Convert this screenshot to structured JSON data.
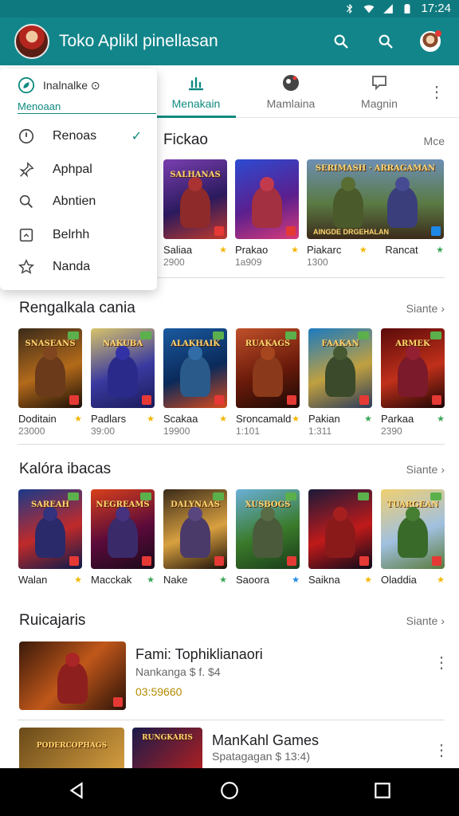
{
  "status": {
    "time": "17:24"
  },
  "app": {
    "title": "Toko Aplikl pinellasan"
  },
  "tabs": [
    {
      "label": ""
    },
    {
      "label": "Menakain"
    },
    {
      "label": "Mamlaina"
    },
    {
      "label": "Magnin"
    }
  ],
  "menu": {
    "header": "Inalnalke ⊙",
    "sub": "Menoaan",
    "items": [
      {
        "label": "Renoas",
        "icon": "info-icon",
        "checked": true
      },
      {
        "label": "Aphpal",
        "icon": "pin-icon"
      },
      {
        "label": "Abntien",
        "icon": "search-icon"
      },
      {
        "label": "Belrhh",
        "icon": "square-icon"
      },
      {
        "label": "Nanda",
        "icon": "star-icon"
      }
    ]
  },
  "sections": {
    "featured": {
      "title": "Fickao",
      "more": "Mce",
      "cards": [
        {
          "cover": "SALHANAS",
          "name": "Saliaa",
          "sub": "2900",
          "star": "y"
        },
        {
          "cover": "",
          "name": "Prakao",
          "sub": "1a909",
          "star": "y"
        },
        {
          "cover": "SERIMASH · ARRAGAMAN",
          "name": "Piakarc",
          "sub": "1300",
          "star": "y"
        },
        {
          "cover": "",
          "name": "Rancat",
          "sub": "",
          "star": "g"
        }
      ],
      "wide_caption": "AINGDE DRGEHALAN"
    },
    "recommended": {
      "title": "Rengalkala cania",
      "more": "Siante",
      "cards": [
        {
          "cover": "SNASEANS",
          "name": "Doditain",
          "sub": "23000",
          "star": "y"
        },
        {
          "cover": "NAKUBA",
          "name": "Padlars",
          "sub": "39:00",
          "star": "y"
        },
        {
          "cover": "ALAKHAIK",
          "name": "Scakaa",
          "sub": "19900",
          "star": "y"
        },
        {
          "cover": "RUAKAGS",
          "name": "Sroncamald",
          "sub": "1:101",
          "star": "y"
        },
        {
          "cover": "FAAKAN",
          "name": "Pakian",
          "sub": "1:311",
          "star": "g"
        },
        {
          "cover": "ARMEK",
          "name": "Parkaa",
          "sub": "2390",
          "star": "g"
        }
      ]
    },
    "category": {
      "title": "Kalóra ibacas",
      "more": "Siante",
      "cards": [
        {
          "cover": "SAREAH",
          "name": "Walan",
          "sub": "",
          "star": "y"
        },
        {
          "cover": "NEGREAMS",
          "name": "Macckak",
          "sub": "",
          "star": "g"
        },
        {
          "cover": "DALYNAAS",
          "name": "Nake",
          "sub": "",
          "star": "g"
        },
        {
          "cover": "XUSBOGS",
          "name": "Saoora",
          "sub": "",
          "star": "b"
        },
        {
          "cover": "",
          "name": "Saikna",
          "sub": "",
          "star": "y"
        },
        {
          "cover": "TUARGEAN",
          "name": "Oladdia",
          "sub": "",
          "star": "y"
        }
      ]
    },
    "list": {
      "title": "Ruicajaris",
      "more": "Siante",
      "rows": [
        {
          "title": "Fami: Tophiklianaori",
          "sub": "Nankanga $ f. $4",
          "price": "03:59660"
        },
        {
          "title": "ManKahl Games",
          "sub": "Spatagagan $ 13:4)",
          "price": "",
          "thumb2": "RUNGKARIS",
          "thumb1": "PODERCOPHAGS"
        }
      ]
    }
  },
  "colors": {
    "appbar": "#12858a",
    "accent": "#0f8a80"
  }
}
